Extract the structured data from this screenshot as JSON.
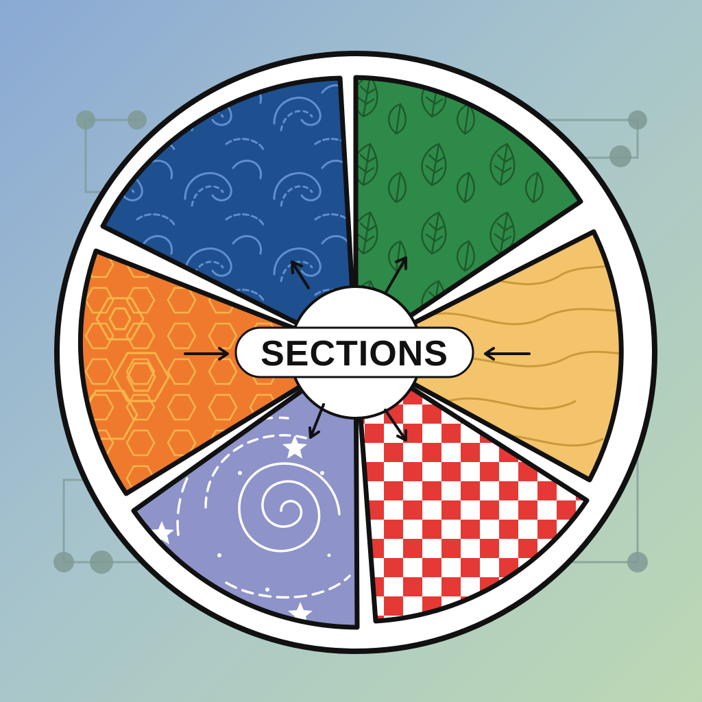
{
  "diagram": {
    "center_label": "SECTIONS",
    "sections": [
      {
        "name": "wave-section",
        "pattern": "waves",
        "color": "#1e4f8f"
      },
      {
        "name": "leaf-section",
        "pattern": "leaves",
        "color": "#2e8a48"
      },
      {
        "name": "dune-section",
        "pattern": "dunes",
        "color": "#f3c46c"
      },
      {
        "name": "checker-section",
        "pattern": "checkerboard",
        "color": "#e53935"
      },
      {
        "name": "galaxy-section",
        "pattern": "spiral-stars",
        "color": "#8e93c9"
      },
      {
        "name": "honeycomb-section",
        "pattern": "hexagons",
        "color": "#ef7a2e"
      }
    ],
    "colors": {
      "outline": "#111111",
      "ring": "#ffffff",
      "connector": "#7f9a94"
    }
  }
}
